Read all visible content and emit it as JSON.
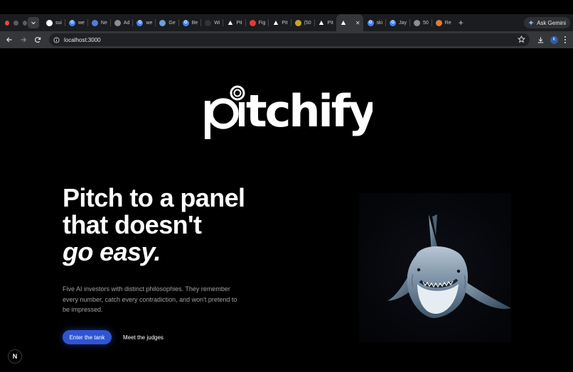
{
  "browser": {
    "tabs": [
      {
        "title": "sui",
        "icon": "github-icon",
        "color": "#ffffff",
        "glyph": ""
      },
      {
        "title": "we",
        "icon": "google-icon",
        "color": "#4285f4",
        "glyph": "G"
      },
      {
        "title": "Ne",
        "icon": "site-icon",
        "color": "#4a7fe0",
        "glyph": ""
      },
      {
        "title": "Ad",
        "icon": "openai-icon",
        "color": "#8e8e8e",
        "glyph": ""
      },
      {
        "title": "we",
        "icon": "google-icon",
        "color": "#4285f4",
        "glyph": "G"
      },
      {
        "title": "Ge",
        "icon": "vercel-icon",
        "color": "#6fa0d8",
        "glyph": ""
      },
      {
        "title": "Be",
        "icon": "google-icon",
        "color": "#4285f4",
        "glyph": "G"
      },
      {
        "title": "Wi",
        "icon": "wiki-icon",
        "color": "#333333",
        "glyph": ""
      },
      {
        "title": "Pit",
        "icon": "vercel-triangle-icon",
        "color": "#ffffff",
        "glyph": ""
      },
      {
        "title": "Fig",
        "icon": "youtube-icon",
        "color": "#e53935",
        "glyph": ""
      },
      {
        "title": "Pit",
        "icon": "vercel-triangle-icon",
        "color": "#ffffff",
        "glyph": ""
      },
      {
        "title": "(50",
        "icon": "mail-icon",
        "color": "#c9a227",
        "glyph": ""
      },
      {
        "title": "Pit",
        "icon": "vercel-triangle-icon",
        "color": "#ffffff",
        "glyph": ""
      },
      {
        "title": "",
        "icon": "vercel-triangle-icon",
        "color": "#ffffff",
        "glyph": "",
        "active": true
      },
      {
        "title": "ski",
        "icon": "google-icon",
        "color": "#4285f4",
        "glyph": "G"
      },
      {
        "title": "Jay",
        "icon": "google-icon",
        "color": "#4285f4",
        "glyph": "G"
      },
      {
        "title": "50",
        "icon": "openai-icon",
        "color": "#8e8e8e",
        "glyph": ""
      },
      {
        "title": "Re",
        "icon": "reddit-icon",
        "color": "#e07b39",
        "glyph": ""
      }
    ],
    "gemini_label": "Ask Gemini",
    "url": "localhost:3000",
    "profile_initial": "K"
  },
  "page": {
    "logo_text": "pitchify",
    "hero": {
      "line1": "Pitch to a panel",
      "line2": "that doesn't",
      "line3": "go easy.",
      "description": "Five AI investors with distinct philosophies. They remember every number, catch every contradiction, and won't pretend to be impressed."
    },
    "primary_cta": "Enter the tank",
    "secondary_cta": "Meet the judges",
    "next_badge": "N"
  },
  "colors": {
    "background": "#000000",
    "primary_button": "#2f55d4",
    "muted_text": "#a1a1a6"
  }
}
